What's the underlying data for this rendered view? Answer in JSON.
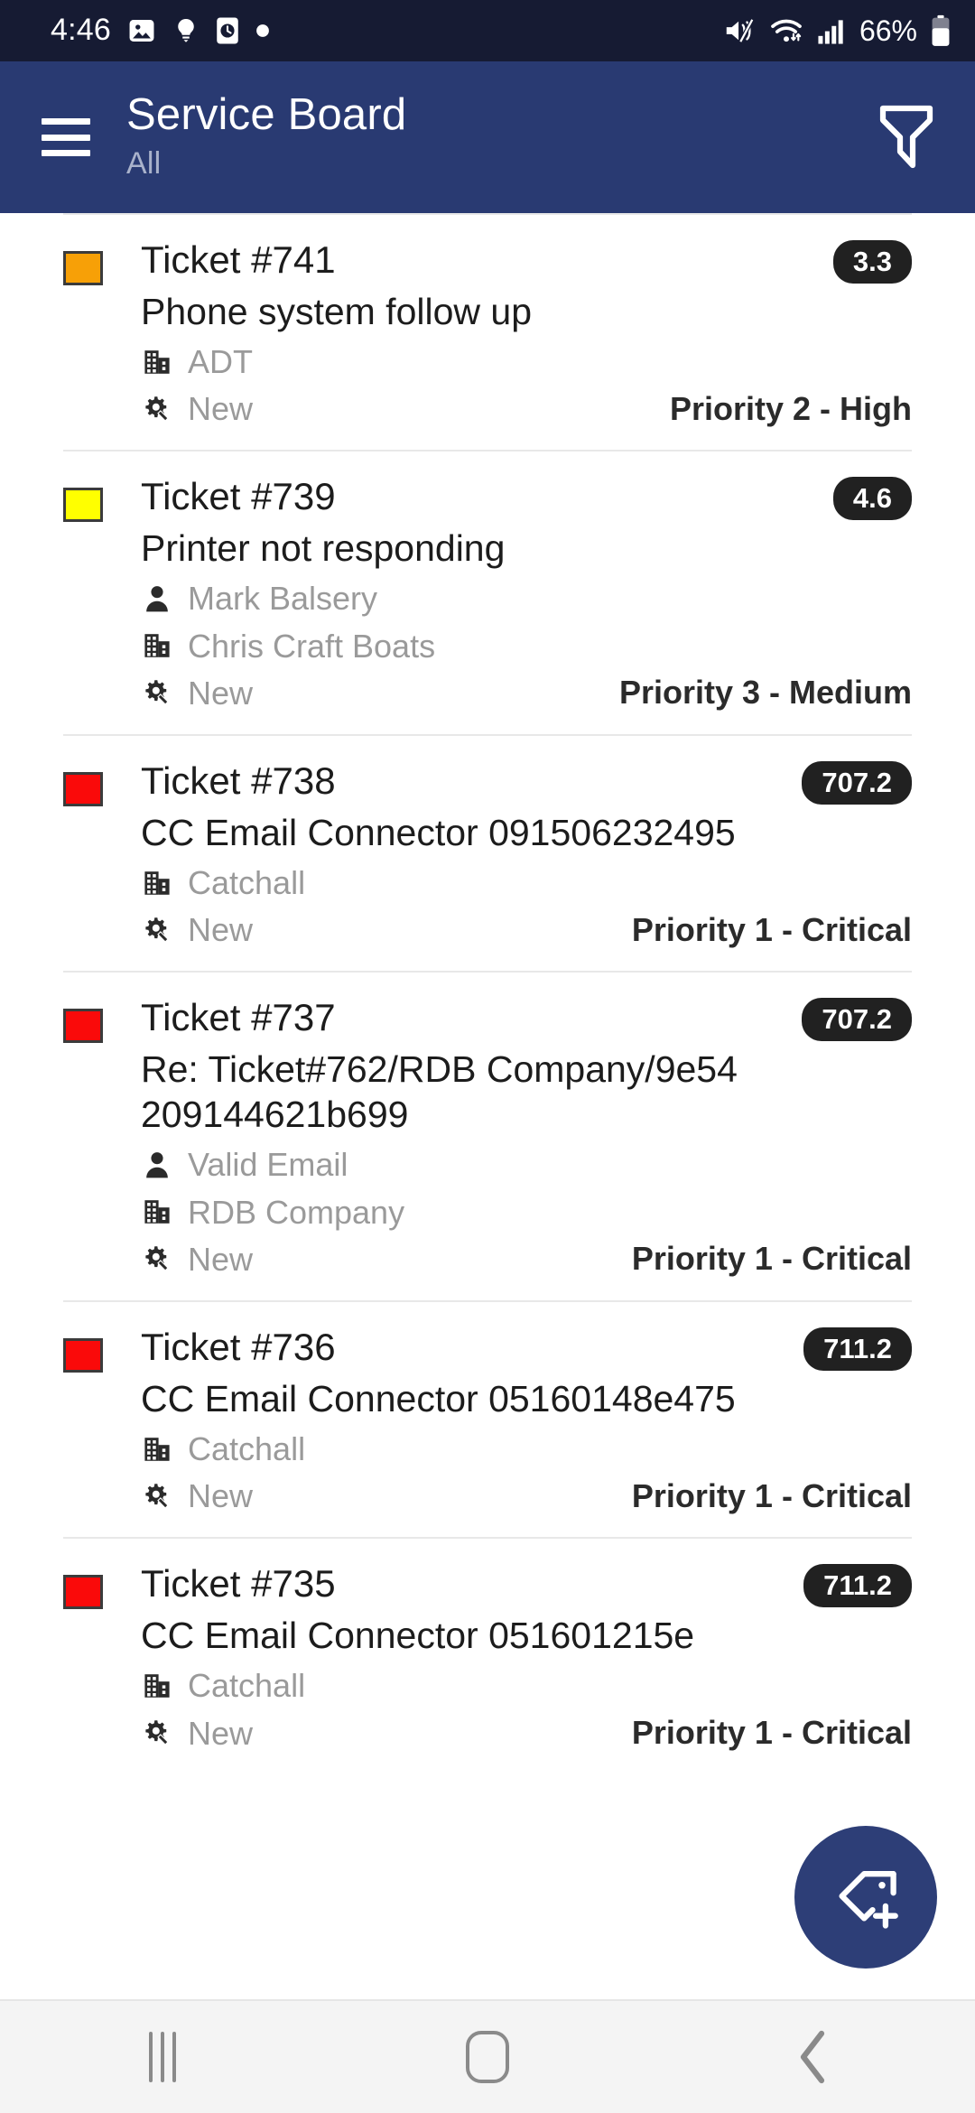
{
  "status_bar": {
    "time": "4:46",
    "left_icons": [
      "image-icon",
      "lightbulb-icon",
      "clock-card-icon",
      "dot-icon"
    ],
    "right_icons": [
      "mute-icon",
      "wifi-icon",
      "cellular-signal-icon"
    ],
    "battery_percent": "66%"
  },
  "app_bar": {
    "menu_icon": "hamburger-menu-icon",
    "title": "Service Board",
    "subtitle": "All",
    "filter_icon": "filter-funnel-icon",
    "background_color": "#293A72"
  },
  "fab": {
    "icon": "tag-plus-icon",
    "color": "#2D3E77"
  },
  "nav_bar": {
    "recents_label": "recents-button",
    "home_label": "home-button",
    "back_label": "back-button"
  },
  "colors": {
    "status_orange": "#F7A007",
    "status_yellow": "#FFFF00",
    "status_red": "#FA0A0A",
    "badge_bg": "#212121",
    "meta_text": "#9A9A9A"
  },
  "tickets": [
    {
      "swatch_color": "#F7A007",
      "number": "Ticket #741",
      "badge": "3.3",
      "summary": "Phone system follow up",
      "contact": null,
      "company": "ADT",
      "status": "New",
      "priority": "Priority 2 - High"
    },
    {
      "swatch_color": "#FFFF00",
      "number": "Ticket #739",
      "badge": "4.6",
      "summary": "Printer not responding",
      "contact": "Mark Balsery",
      "company": "Chris Craft Boats",
      "status": "New",
      "priority": "Priority 3 - Medium"
    },
    {
      "swatch_color": "#FA0A0A",
      "number": "Ticket #738",
      "badge": "707.2",
      "summary": "CC Email Connector 091506232495",
      "contact": null,
      "company": "Catchall",
      "status": "New",
      "priority": "Priority 1 - Critical"
    },
    {
      "swatch_color": "#FA0A0A",
      "number": "Ticket #737",
      "badge": "707.2",
      "summary": "Re: Ticket#762/RDB Company/9e54 209144621b699",
      "contact": "Valid Email",
      "company": "RDB Company",
      "status": "New",
      "priority": "Priority 1 - Critical"
    },
    {
      "swatch_color": "#FA0A0A",
      "number": "Ticket #736",
      "badge": "711.2",
      "summary": "CC Email Connector 05160148e475",
      "contact": null,
      "company": "Catchall",
      "status": "New",
      "priority": "Priority 1 - Critical"
    },
    {
      "swatch_color": "#FA0A0A",
      "number": "Ticket #735",
      "badge": "711.2",
      "summary": "CC Email Connector 051601215e",
      "contact": null,
      "company": "Catchall",
      "status": "New",
      "priority": "Priority 1 - Critical"
    }
  ]
}
